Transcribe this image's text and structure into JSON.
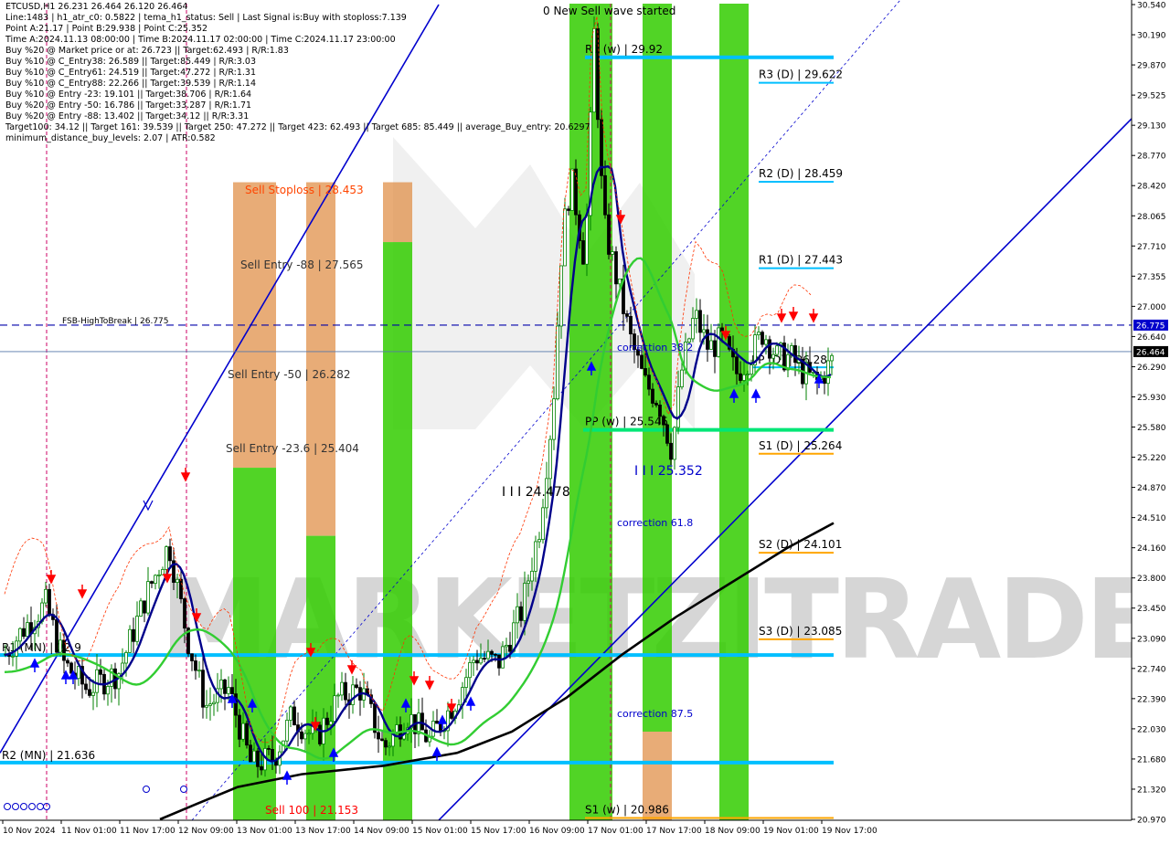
{
  "chart_data": {
    "type": "candlestick",
    "symbol_line": "ETCUSD,H1  26.231 26.464 26.120 26.464",
    "info_lines": [
      "Line:1483 | h1_atr_c0: 0.5822 | tema_h1_status: Sell | Last Signal is:Buy with stoploss:7.139",
      "Point A:21.17 | Point B:29.938 | Point C:25.352",
      "Time A:2024.11.13 08:00:00 | Time B:2024.11.17 02:00:00 | Time C:2024.11.17 23:00:00",
      "Buy %20 @ Market price or at: 26.723 || Target:62.493 | R/R:1.83",
      "Buy %10 @ C_Entry38: 26.589 || Target:85.449 | R/R:3.03",
      "Buy %10 @ C_Entry61: 24.519 || Target:47.272 | R/R:1.31",
      "Buy %10 @ C_Entry88: 22.266 || Target:39.539 | R/R:1.14",
      "Buy %10 @ Entry -23: 19.101 || Target:38.706 | R/R:1.64",
      "Buy %20 @ Entry -50: 16.786 || Target:33.287 | R/R:1.71",
      "Buy %20 @ Entry -88: 13.402 || Target:34.12 || R/R:3.31",
      "Target100: 34.12 || Target 161: 39.539 || Target 250: 47.272 || Target 423: 62.493 || Target 685: 85.449 || average_Buy_entry: 20.6297",
      "minimum_distance_buy_levels: 2.07 | ATR:0.582"
    ],
    "title_annotation": "0 New Sell wave started",
    "watermark": "MARKETZITRADE",
    "y_ticks": [
      "30.540",
      "30.190",
      "29.870",
      "29.525",
      "29.130",
      "28.770",
      "28.420",
      "28.065",
      "27.710",
      "27.355",
      "27.000",
      "26.640",
      "26.290",
      "25.930",
      "25.580",
      "25.220",
      "24.870",
      "24.510",
      "24.160",
      "23.800",
      "23.450",
      "23.090",
      "22.740",
      "22.390",
      "22.030",
      "21.680",
      "21.320",
      "20.970"
    ],
    "x_ticks": [
      "10 Nov 2024",
      "11 Nov 01:00",
      "11 Nov 17:00",
      "12 Nov 09:00",
      "13 Nov 01:00",
      "13 Nov 17:00",
      "14 Nov 09:00",
      "15 Nov 01:00",
      "15 Nov 17:00",
      "16 Nov 09:00",
      "17 Nov 01:00",
      "17 Nov 17:00",
      "18 Nov 09:00",
      "19 Nov 01:00",
      "19 Nov 17:00"
    ],
    "price_badges": [
      {
        "label": "26.775",
        "price": 26.775,
        "color": "#0000cc"
      },
      {
        "label": "26.464",
        "price": 26.464,
        "color": "#000000"
      }
    ],
    "price_range": [
      20.97,
      30.54
    ],
    "current_price": 26.464,
    "levels": [
      {
        "label": "R1 (w) | 29.92",
        "price": 29.92,
        "color": "#00bfff"
      },
      {
        "label": "R3 (D) | 29.622",
        "price": 29.622,
        "color": "#00bfff"
      },
      {
        "label": "R2 (D) | 28.459",
        "price": 28.459,
        "color": "#00bfff"
      },
      {
        "label": "R1 (D) | 27.443",
        "price": 27.443,
        "color": "#00bfff"
      },
      {
        "label": "FSB-HighToBreak | 26.775",
        "price": 26.775,
        "color": "#0000aa"
      },
      {
        "label": "PP (D) | 26.28",
        "price": 26.28,
        "color": "#00bfff"
      },
      {
        "label": "PP (w) | 25.545",
        "price": 25.545,
        "color": "#00e676"
      },
      {
        "label": "S1 (D) | 25.264",
        "price": 25.264,
        "color": "#ffa500"
      },
      {
        "label": "S2 (D) | 24.101",
        "price": 24.101,
        "color": "#ffa500"
      },
      {
        "label": "S3 (D) | 23.085",
        "price": 23.085,
        "color": "#ffa500"
      },
      {
        "label": "R1 (MN) | 22.9",
        "price": 22.9,
        "color": "#00bfff"
      },
      {
        "label": "R2 (MN) | 21.636",
        "price": 21.636,
        "color": "#00bfff"
      },
      {
        "label": "S1 (w) | 20.986",
        "price": 20.986,
        "color": "#ffa500"
      }
    ],
    "annotations": [
      {
        "text": "Sell Stoploss | 28.453",
        "color": "#ff4500"
      },
      {
        "text": "Sell Entry -88 | 27.565",
        "color": "#333333"
      },
      {
        "text": "Sell Entry -50 | 26.282",
        "color": "#333333"
      },
      {
        "text": "Sell Entry -23.6 | 25.404",
        "color": "#333333"
      },
      {
        "text": "Sell 100 | 21.153",
        "color": "#ff0000"
      },
      {
        "text": "correction 38.2",
        "color": "#0000cc"
      },
      {
        "text": "correction 61.8",
        "color": "#0000cc"
      },
      {
        "text": "correction 87.5",
        "color": "#0000cc"
      },
      {
        "text": "I I I 24.478",
        "color": "#000000"
      },
      {
        "text": "I I I 25.352",
        "color": "#0000cc"
      }
    ],
    "colors": {
      "candle_up": "#008000",
      "candle_down": "#000000",
      "ma_fast": "#00008b",
      "ma_mid": "#32cd32",
      "ma_slow": "#000000",
      "channel": "#0000cd",
      "green_band": "#33cc00",
      "orange_band": "#e0904a"
    }
  }
}
